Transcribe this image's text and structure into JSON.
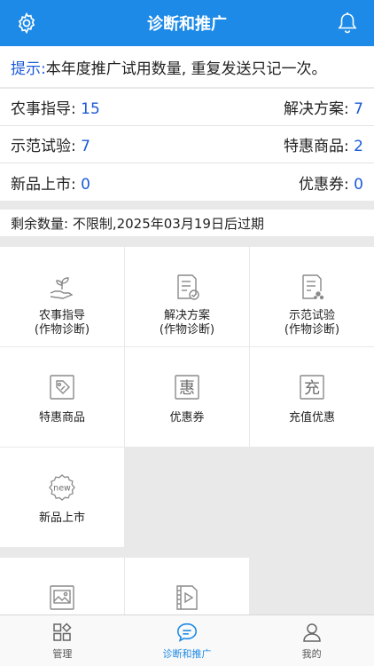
{
  "header": {
    "title": "诊断和推广",
    "left_icon": "gear-icon",
    "right_icon": "bell-icon"
  },
  "notice": {
    "label": "提示:",
    "text": " 本年度推广试用数量, 重复发送只记一次。"
  },
  "stats": [
    {
      "left_label": "农事指导: ",
      "left_value": "15",
      "right_label": "解决方案: ",
      "right_value": "7"
    },
    {
      "left_label": "示范试验: ",
      "left_value": "7",
      "right_label": "特惠商品: ",
      "right_value": "2"
    },
    {
      "left_label": "新品上市: ",
      "left_value": "0",
      "right_label": "优惠券: ",
      "right_value": "0"
    }
  ],
  "remaining": "剩余数量: 不限制,2025年03月19日后过期",
  "grid": [
    {
      "label": "农事指导",
      "sub": "(作物诊断)",
      "icon": "plant-hand-icon"
    },
    {
      "label": "解决方案",
      "sub": "(作物诊断)",
      "icon": "document-check-icon"
    },
    {
      "label": "示范试验",
      "sub": "(作物诊断)",
      "icon": "document-trial-icon"
    },
    {
      "label": "特惠商品",
      "sub": "",
      "icon": "discount-tag-icon"
    },
    {
      "label": "优惠券",
      "sub": "",
      "icon": "coupon-icon",
      "glyph": "惠"
    },
    {
      "label": "充值优惠",
      "sub": "",
      "icon": "recharge-icon",
      "glyph": "充"
    },
    {
      "label": "新品上市",
      "sub": "",
      "icon": "new-badge-icon",
      "glyph": "new"
    },
    {
      "label": "",
      "sub": "",
      "icon": "image-icon"
    },
    {
      "label": "",
      "sub": "",
      "icon": "video-icon"
    }
  ],
  "tabbar": [
    {
      "label": "管理",
      "icon": "grid-manage-icon",
      "active": false
    },
    {
      "label": "诊断和推广",
      "icon": "chat-bubble-icon",
      "active": true
    },
    {
      "label": "我的",
      "icon": "user-icon",
      "active": false
    }
  ],
  "colors": {
    "primary": "#1c8ae6",
    "value_blue": "#1c5ad8",
    "icon_gray": "#8a8a8a"
  }
}
